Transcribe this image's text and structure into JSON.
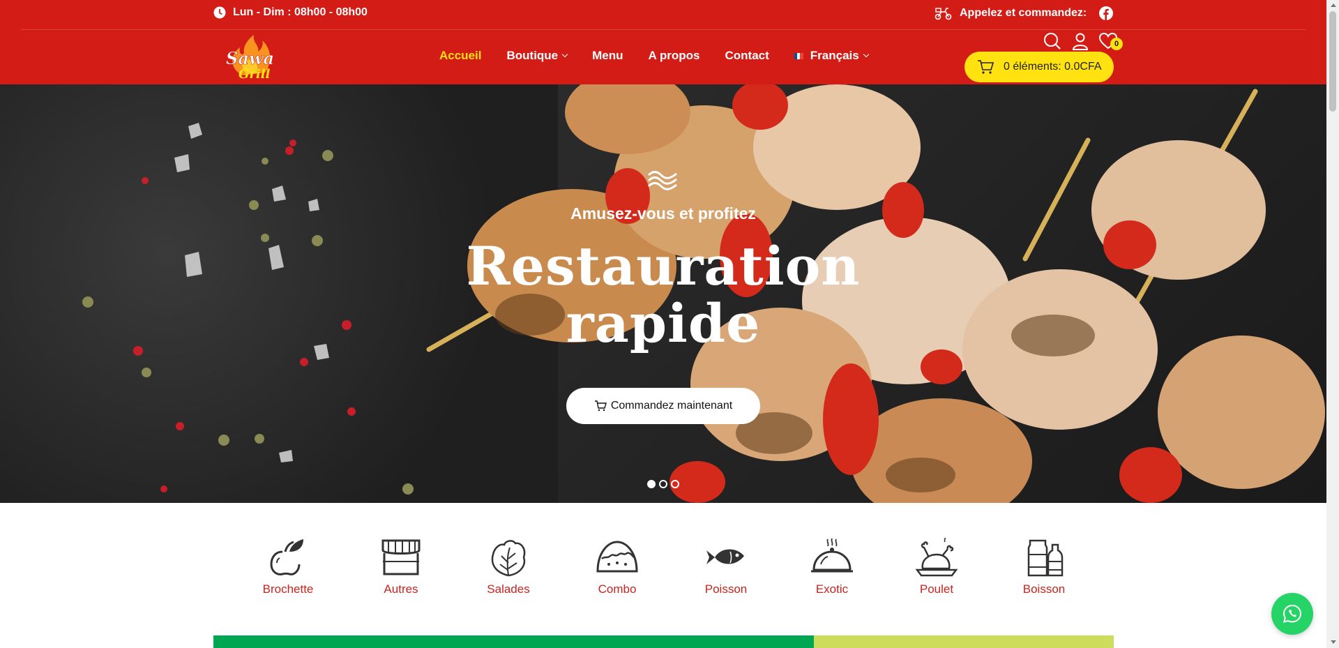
{
  "header": {
    "hours": "Lun - Dim : 08h00 - 08h00",
    "call_label": "Appelez et commandez:",
    "brand_color": "#d41c17",
    "accent_color": "#ffe20f",
    "logo_text": "Sawa Grill",
    "nav": [
      {
        "label": "Accueil",
        "active": true
      },
      {
        "label": "Boutique",
        "dropdown": true
      },
      {
        "label": "Menu"
      },
      {
        "label": "A propos"
      },
      {
        "label": "Contact"
      },
      {
        "label": "Français",
        "dropdown": true
      }
    ],
    "wishlist_count": "0",
    "cart_label": "0 éléments: 0.0CFA"
  },
  "hero": {
    "kicker": "Amusez-vous et profitez",
    "title_line1": "Restauration",
    "title_line2": "rapide",
    "cta": "Commandez maintenant",
    "slides": 3,
    "active_slide": 1
  },
  "categories": [
    {
      "label": "Brochette",
      "icon": "apple-icon"
    },
    {
      "label": "Autres",
      "icon": "shop-icon"
    },
    {
      "label": "Salades",
      "icon": "lettuce-icon"
    },
    {
      "label": "Combo",
      "icon": "taco-icon"
    },
    {
      "label": "Poisson",
      "icon": "fish-icon"
    },
    {
      "label": "Exotic",
      "icon": "cloche-icon"
    },
    {
      "label": "Poulet",
      "icon": "roast-chicken-icon"
    },
    {
      "label": "Boisson",
      "icon": "bottles-icon"
    }
  ],
  "whatsapp_color": "#25d366"
}
